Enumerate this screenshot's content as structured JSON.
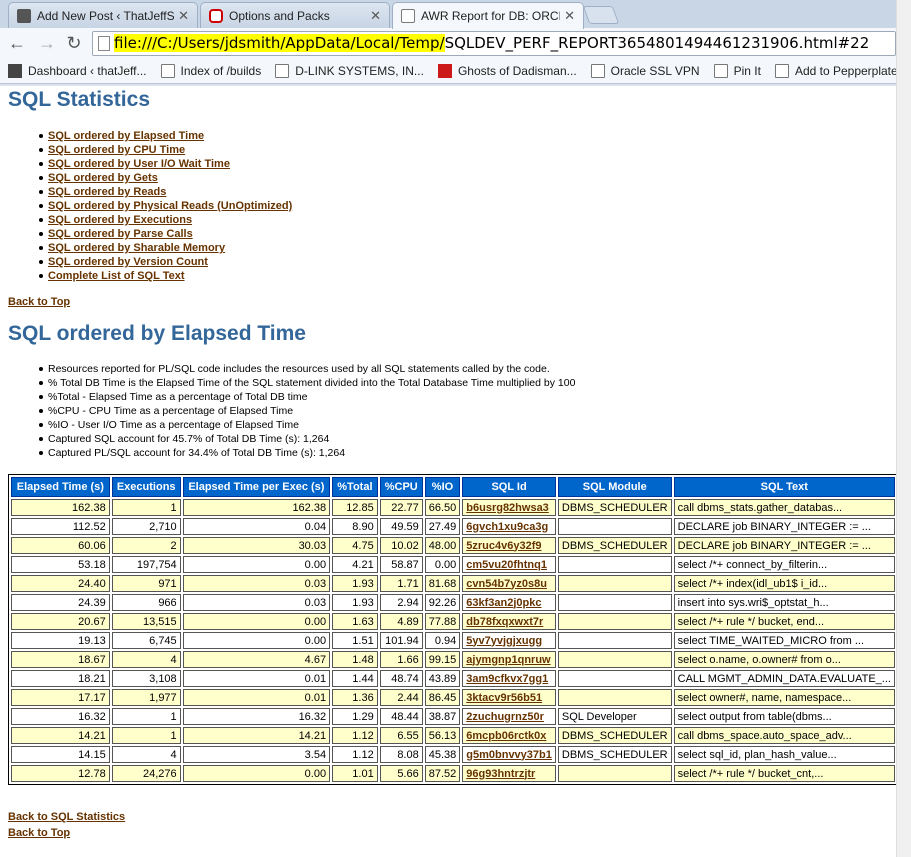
{
  "browser": {
    "tabs": [
      {
        "title": "Add New Post ‹ ThatJeffSm",
        "icon": "site-favicon"
      },
      {
        "title": "Options and Packs",
        "icon": "oracle-favicon"
      },
      {
        "title": "AWR Report for DB: ORCL",
        "icon": "page-icon"
      }
    ],
    "url_highlight": "file:///C:/Users/jdsmith/AppData/Local/Temp/",
    "url_rest": "SQLDEV_PERF_REPORT3654801494461231906.html#22",
    "bookmarks": [
      "Dashboard ‹ thatJeff...",
      "Index of /builds",
      "D-LINK SYSTEMS, IN...",
      "Ghosts of Dadisman...",
      "Oracle SSL VPN",
      "Pin It",
      "Add to Pepperplate"
    ]
  },
  "page": {
    "title": "SQL Statistics",
    "links": [
      "SQL ordered by Elapsed Time",
      "SQL ordered by CPU Time",
      "SQL ordered by User I/O Wait Time",
      "SQL ordered by Gets",
      "SQL ordered by Reads",
      "SQL ordered by Physical Reads (UnOptimized)",
      "SQL ordered by Executions",
      "SQL ordered by Parse Calls",
      "SQL ordered by Sharable Memory",
      "SQL ordered by Version Count",
      "Complete List of SQL Text"
    ],
    "back_to_top": "Back to Top",
    "section_title": "SQL ordered by Elapsed Time",
    "notes": [
      "Resources reported for PL/SQL code includes the resources used by all SQL statements called by the code.",
      "% Total DB Time is the Elapsed Time of the SQL statement divided into the Total Database Time multiplied by 100",
      "%Total - Elapsed Time as a percentage of Total DB time",
      "%CPU - CPU Time as a percentage of Elapsed Time",
      "%IO - User I/O Time as a percentage of Elapsed Time",
      "Captured SQL account for 45.7% of Total DB Time (s): 1,264",
      "Captured PL/SQL account for 34.4% of Total DB Time (s): 1,264"
    ],
    "back_to_sql_statistics": "Back to SQL Statistics",
    "back_to_top_2": "Back to Top"
  },
  "table": {
    "headers": [
      "Elapsed Time (s)",
      "Executions",
      "Elapsed Time per Exec (s)",
      "%Total",
      "%CPU",
      "%IO",
      "SQL Id",
      "SQL Module",
      "SQL Text"
    ],
    "rows": [
      [
        "162.38",
        "1",
        "162.38",
        "12.85",
        "22.77",
        "66.50",
        "b6usrg82hwsa3",
        "DBMS_SCHEDULER",
        "call dbms_stats.gather_databas..."
      ],
      [
        "112.52",
        "2,710",
        "0.04",
        "8.90",
        "49.59",
        "27.49",
        "6gvch1xu9ca3g",
        "",
        "DECLARE job BINARY_INTEGER := ..."
      ],
      [
        "60.06",
        "2",
        "30.03",
        "4.75",
        "10.02",
        "48.00",
        "5zruc4v6y32f9",
        "DBMS_SCHEDULER",
        "DECLARE job BINARY_INTEGER := ..."
      ],
      [
        "53.18",
        "197,754",
        "0.00",
        "4.21",
        "58.87",
        "0.00",
        "cm5vu20fhtnq1",
        "",
        "select /*+ connect_by_filterin..."
      ],
      [
        "24.40",
        "971",
        "0.03",
        "1.93",
        "1.71",
        "81.68",
        "cvn54b7yz0s8u",
        "",
        "select /*+ index(idl_ub1$ i_id..."
      ],
      [
        "24.39",
        "966",
        "0.03",
        "1.93",
        "2.94",
        "92.26",
        "63kf3an2j0pkc",
        "",
        "insert into sys.wri$_optstat_h..."
      ],
      [
        "20.67",
        "13,515",
        "0.00",
        "1.63",
        "4.89",
        "77.88",
        "db78fxqxwxt7r",
        "",
        "select /*+ rule */ bucket, end..."
      ],
      [
        "19.13",
        "6,745",
        "0.00",
        "1.51",
        "101.94",
        "0.94",
        "5yv7yvjgjxugg",
        "",
        "select TIME_WAITED_MICRO from ..."
      ],
      [
        "18.67",
        "4",
        "4.67",
        "1.48",
        "1.66",
        "99.15",
        "ajymgnp1qnruw",
        "",
        "select o.name, o.owner# from o..."
      ],
      [
        "18.21",
        "3,108",
        "0.01",
        "1.44",
        "48.74",
        "43.89",
        "3am9cfkvx7gg1",
        "",
        "CALL MGMT_ADMIN_DATA.EVALUATE_..."
      ],
      [
        "17.17",
        "1,977",
        "0.01",
        "1.36",
        "2.44",
        "86.45",
        "3ktacv9r56b51",
        "",
        "select owner#, name, namespace..."
      ],
      [
        "16.32",
        "1",
        "16.32",
        "1.29",
        "48.44",
        "38.87",
        "2zuchugrnz50r",
        "SQL Developer",
        "select output from table(dbms..."
      ],
      [
        "14.21",
        "1",
        "14.21",
        "1.12",
        "6.55",
        "56.13",
        "6mcpb06rctk0x",
        "DBMS_SCHEDULER",
        "call dbms_space.auto_space_adv..."
      ],
      [
        "14.15",
        "4",
        "3.54",
        "1.12",
        "8.08",
        "45.38",
        "g5m0bnvvy37b1",
        "DBMS_SCHEDULER",
        "select sql_id, plan_hash_value..."
      ],
      [
        "12.78",
        "24,276",
        "0.00",
        "1.01",
        "5.66",
        "87.52",
        "96g93hntrzjtr",
        "",
        "select /*+ rule */ bucket_cnt,..."
      ]
    ]
  }
}
